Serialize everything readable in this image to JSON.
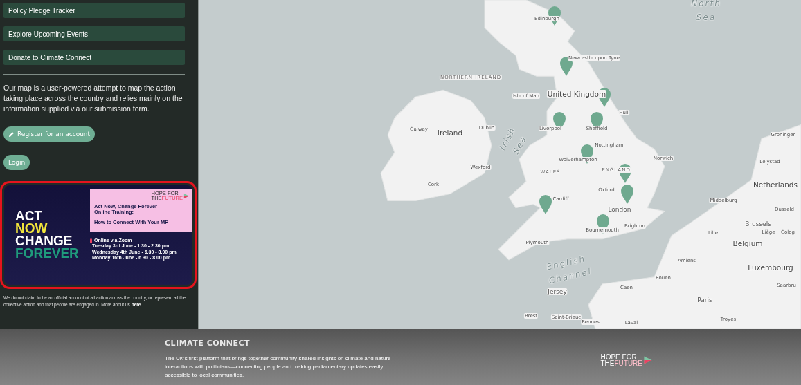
{
  "sidebar": {
    "nav_buttons": [
      "Policy Pledge Tracker",
      "Explore Upcoming Events",
      "Donate to Climate Connect"
    ],
    "intro": "Our map is a user-powered attempt to map the action taking place across the country and relies mainly on the information supplied via our submission form.",
    "register_button": "Register for an account",
    "login_button": "Login",
    "banner": {
      "highlighted": true,
      "headline": [
        {
          "text": "ACT",
          "color": "#ffffff"
        },
        {
          "text": "NOW",
          "color": "#f2e53b"
        },
        {
          "text": "CHANGE",
          "color": "#ffffff"
        },
        {
          "text": "FOREVER",
          "color": "#1f9a7c"
        }
      ],
      "logo": {
        "line1": "HOPE FOR",
        "line2a": "THE",
        "line2b": "FUTURE"
      },
      "title": "Act Now, Change Forever Online Training:",
      "subtitle": "How to Connect With Your MP",
      "location": "Online via Zoom",
      "sessions": [
        "Tuesday 3rd June - 1.30 - 2.30 pm",
        "Wednesday 4th June - 6.30 - 8.00 pm",
        "Monday 16th June - 6.30 - 8.00 pm"
      ]
    },
    "disclaimer": "We do not claim to be an official account of all action across the country, or represent all the collective action and that people are engaged in. More about us ",
    "disclaimer_link": "here"
  },
  "map": {
    "labels": [
      {
        "text": "Edinburgh",
        "kind": "city"
      },
      {
        "text": "North Sea",
        "kind": "sea"
      },
      {
        "text": "Newcastle upon Tyne",
        "kind": "city"
      },
      {
        "text": "NORTHERN IRELAND",
        "kind": "region"
      },
      {
        "text": "Isle of Man",
        "kind": "city"
      },
      {
        "text": "United Kingdom",
        "kind": "country"
      },
      {
        "text": "Hull",
        "kind": "city"
      },
      {
        "text": "Irish Sea",
        "kind": "sea"
      },
      {
        "text": "Galway",
        "kind": "city"
      },
      {
        "text": "Ireland",
        "kind": "country"
      },
      {
        "text": "Dublin",
        "kind": "city"
      },
      {
        "text": "Liverpool",
        "kind": "city"
      },
      {
        "text": "Sheffield",
        "kind": "city"
      },
      {
        "text": "Nottingham",
        "kind": "city"
      },
      {
        "text": "Wolverhampton",
        "kind": "city"
      },
      {
        "text": "Norwich",
        "kind": "city"
      },
      {
        "text": "Groninger",
        "kind": "city"
      },
      {
        "text": "Lelystad",
        "kind": "city"
      },
      {
        "text": "Wexford",
        "kind": "city"
      },
      {
        "text": "WALES",
        "kind": "region"
      },
      {
        "text": "ENGLAND",
        "kind": "region"
      },
      {
        "text": "Netherlands",
        "kind": "country"
      },
      {
        "text": "Cork",
        "kind": "city"
      },
      {
        "text": "Oxford",
        "kind": "city"
      },
      {
        "text": "Cardiff",
        "kind": "city"
      },
      {
        "text": "Middelburg",
        "kind": "city"
      },
      {
        "text": "Dusseld",
        "kind": "city"
      },
      {
        "text": "London",
        "kind": "bigcity"
      },
      {
        "text": "Brussels",
        "kind": "bigcity"
      },
      {
        "text": "Lille",
        "kind": "city"
      },
      {
        "text": "Liège",
        "kind": "city"
      },
      {
        "text": "Colog",
        "kind": "city"
      },
      {
        "text": "Brighton",
        "kind": "city"
      },
      {
        "text": "Bournemouth",
        "kind": "city"
      },
      {
        "text": "Belgium",
        "kind": "country"
      },
      {
        "text": "Plymouth",
        "kind": "city"
      },
      {
        "text": "Luxembourg",
        "kind": "country"
      },
      {
        "text": "Amiens",
        "kind": "city"
      },
      {
        "text": "English Channel",
        "kind": "sea"
      },
      {
        "text": "Rouen",
        "kind": "city"
      },
      {
        "text": "Saarbru",
        "kind": "city"
      },
      {
        "text": "Jersey",
        "kind": "bigcity"
      },
      {
        "text": "Caen",
        "kind": "city"
      },
      {
        "text": "Paris",
        "kind": "bigcity"
      },
      {
        "text": "Brest",
        "kind": "city"
      },
      {
        "text": "Saint-Brieuc",
        "kind": "city"
      },
      {
        "text": "Troyes",
        "kind": "city"
      },
      {
        "text": "Rennes",
        "kind": "city"
      },
      {
        "text": "Laval",
        "kind": "city"
      }
    ]
  },
  "footer": {
    "brand": "CLIMATE CONNECT",
    "description": "The UK's first platform that brings together community-shared insights on climate and nature interactions with politicians—connecting people and making parliamentary updates easily accessible to local communities.",
    "logo": {
      "line1": "HOPE FOR",
      "line2a": "THE",
      "line2b": "FUTURE"
    }
  }
}
